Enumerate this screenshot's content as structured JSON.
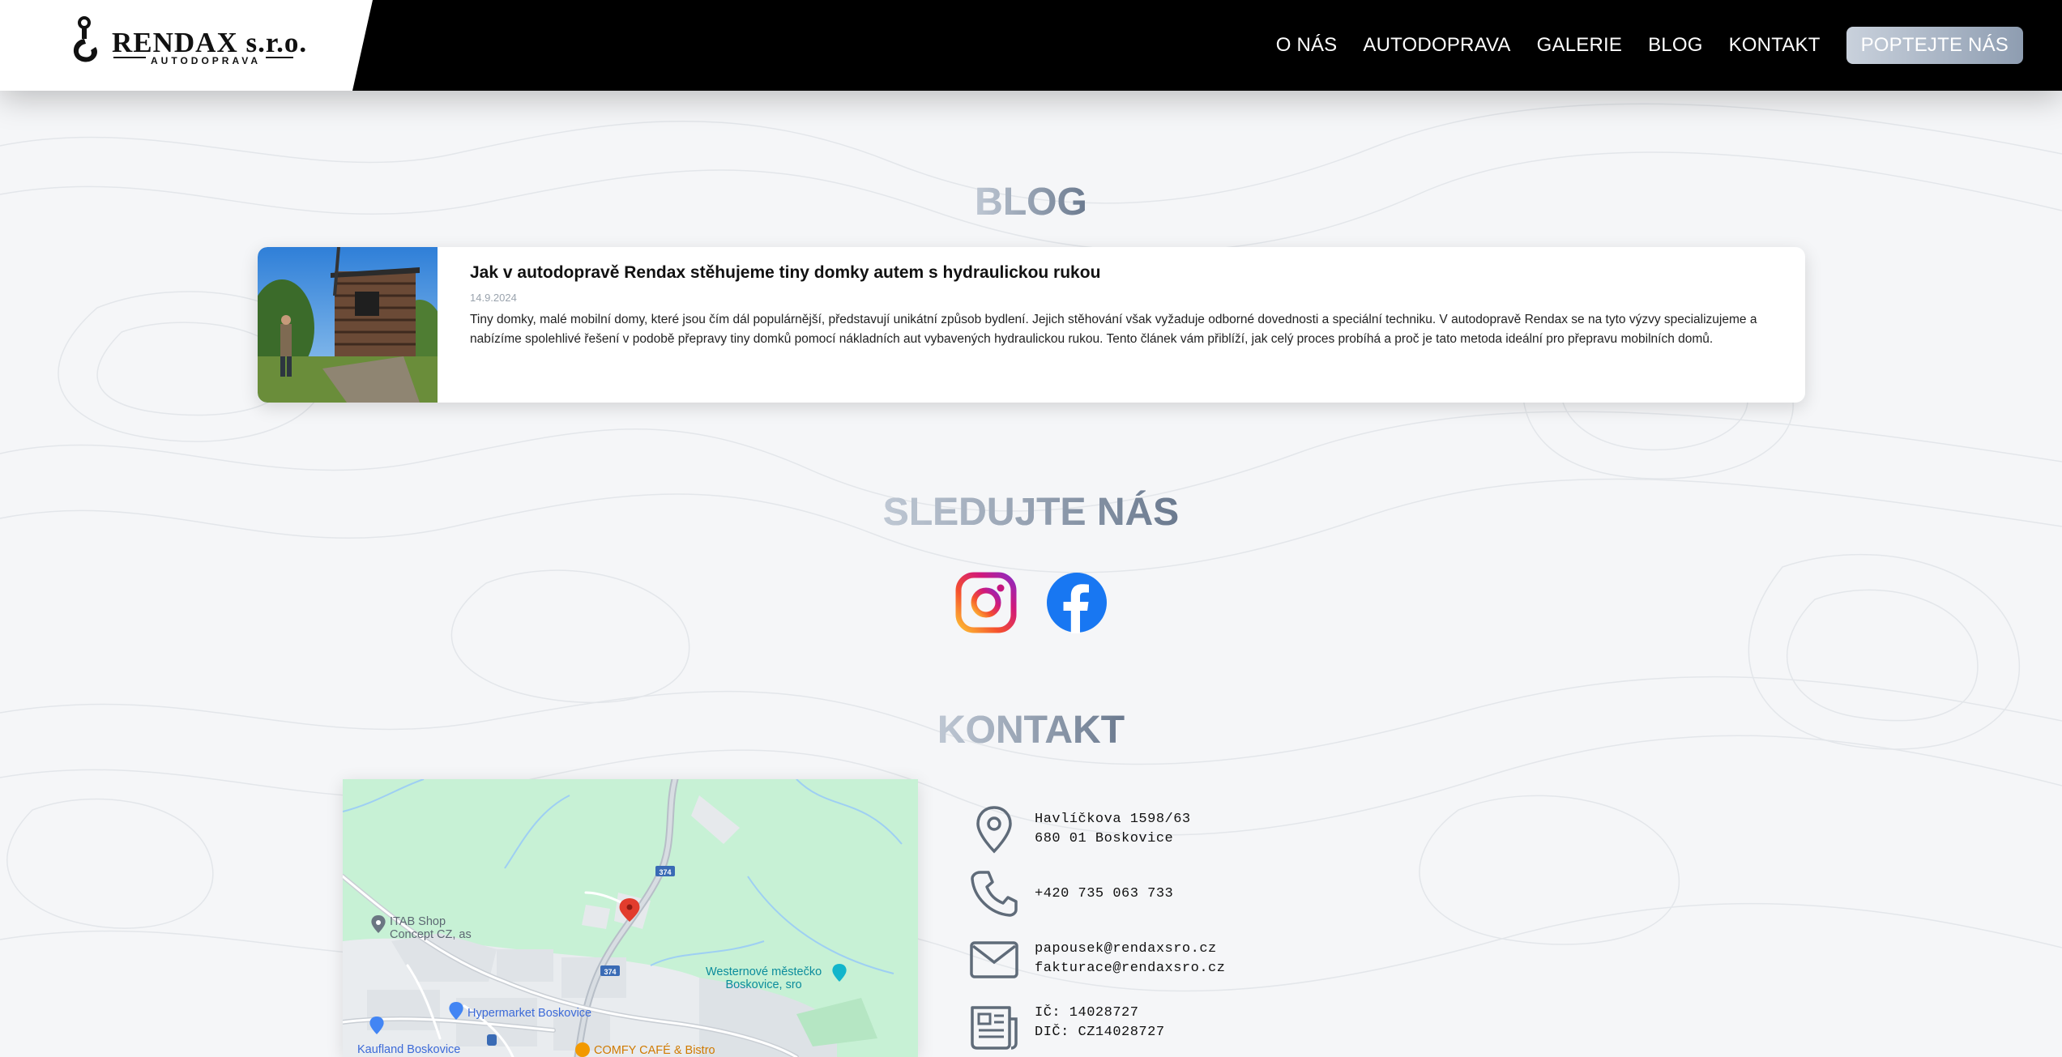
{
  "brand": {
    "name": "RENDAX s.r.o.",
    "tagline": "AUTODOPRAVA"
  },
  "nav": {
    "items": [
      {
        "label": "O NÁS"
      },
      {
        "label": "AUTODOPRAVA"
      },
      {
        "label": "GALERIE"
      },
      {
        "label": "BLOG"
      },
      {
        "label": "KONTAKT"
      }
    ],
    "cta_label": "POPTEJTE NÁS"
  },
  "blog": {
    "title": "BLOG",
    "posts": [
      {
        "title": "Jak v autodopravě Rendax stěhujeme tiny domky autem s hydraulickou rukou",
        "date": "14.9.2024",
        "excerpt": "Tiny domky, malé mobilní domy, které jsou čím dál populárnější, představují unikátní způsob bydlení. Jejich stěhování však vyžaduje odborné dovednosti a speciální techniku. V autodopravě Rendax se na tyto výzvy specializujeme a nabízíme spolehlivé řešení v podobě přepravy tiny domků pomocí nákladních aut vybavených hydraulickou rukou. Tento článek vám přiblíží, jak celý proces probíhá a proč je tato metoda ideální pro přepravu mobilních domů."
      }
    ]
  },
  "social": {
    "title": "SLEDUJTE NÁS",
    "links": [
      {
        "icon": "instagram-icon"
      },
      {
        "icon": "facebook-icon"
      }
    ]
  },
  "contact": {
    "title": "KONTAKT",
    "address_line1": "Havlíčkova 1598/63",
    "address_line2": "680 01 Boskovice",
    "phone": "+420 735 063 733",
    "email1": "papousek@rendaxsro.cz",
    "email2": "fakturace@rendaxsro.cz",
    "ic": "IČ: 14028727",
    "dic": "DIČ: CZ14028727"
  },
  "map": {
    "labels": {
      "itab": "ITAB Shop\nConcept CZ, as",
      "westernove": "Westernové městečko\nBoskovice, sro",
      "hypermarket": "Hypermarket Boskovice",
      "kaufland": "Kaufland Boskovice",
      "comfy": "COMFY CAFÉ & Bistro",
      "road1": "374",
      "road2": "374"
    }
  },
  "colors": {
    "nav_bg": "#000000",
    "page_bg": "#f5f6f8",
    "title_gradient_start": "#c2cad6",
    "title_gradient_end": "#67768b",
    "map_green": "#c8f3d6",
    "facebook_blue": "#1877f2"
  }
}
